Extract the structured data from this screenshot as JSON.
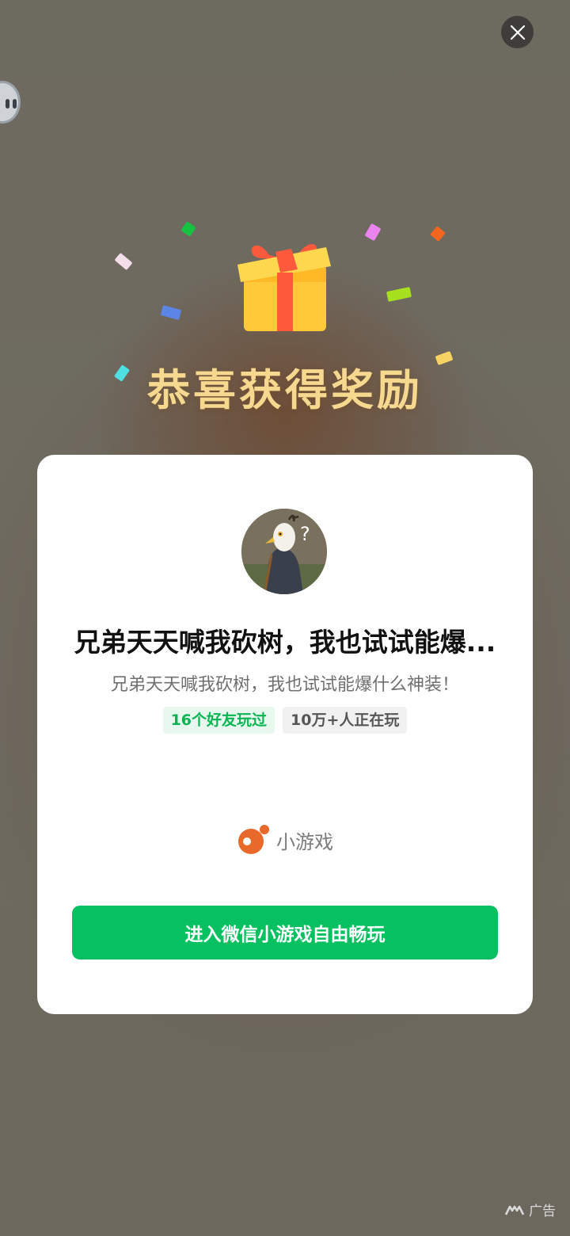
{
  "overlay": {
    "headline": "恭喜获得奖励",
    "close_icon": "close-icon",
    "gift_icon": "gift-icon",
    "side_handle_icon": "floating-assistant-icon"
  },
  "card": {
    "avatar_icon": "game-avatar-image",
    "title": "兄弟天天喊我砍树，我也试试能爆...",
    "description": "兄弟天天喊我砍树，我也试试能爆什么神装！",
    "tags": {
      "friends": "16个好友玩过",
      "players": "10万+人正在玩"
    },
    "brand": {
      "icon": "mini-game-logo-icon",
      "label": "小游戏"
    },
    "cta_label": "进入微信小游戏自由畅玩"
  },
  "ad": {
    "icon": "ad-logo-icon",
    "label": "广告"
  },
  "colors": {
    "accent_green": "#07c160",
    "headline_gold": "#f6d88f",
    "brand_orange": "#e8692a"
  }
}
